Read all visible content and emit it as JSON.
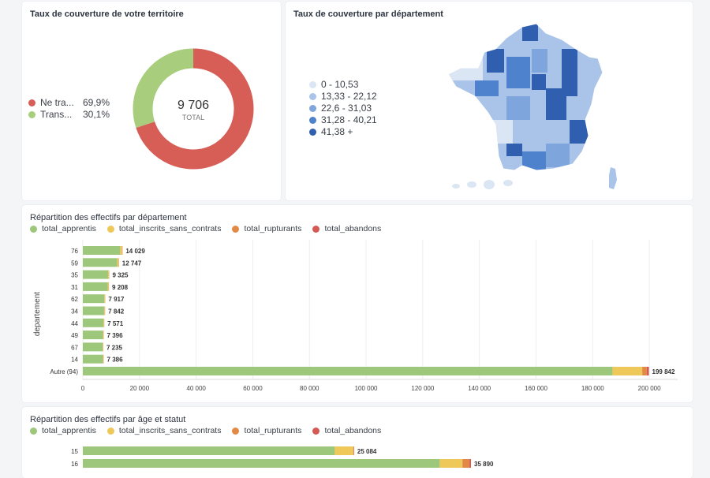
{
  "colors": {
    "apprentis": "#9dc77a",
    "inscrits": "#efc85a",
    "rupturants": "#e28a45",
    "abandons": "#d45a53",
    "donut_red": "#d65e57",
    "donut_green": "#a8cd7c"
  },
  "coverage": {
    "title": "Taux de couverture de votre territoire",
    "total_value": "9 706",
    "total_label": "TOTAL",
    "legend": [
      {
        "label": "Ne tra...",
        "pct": "69,9%",
        "color": "#d65e57"
      },
      {
        "label": "Trans...",
        "pct": "30,1%",
        "color": "#a8cd7c"
      }
    ],
    "chart_data": {
      "type": "pie",
      "categories": [
        "Ne tra...",
        "Trans..."
      ],
      "values": [
        69.9,
        30.1
      ]
    }
  },
  "map": {
    "title": "Taux de couverture par département",
    "legend": [
      {
        "label": "0 - 10,53",
        "color": "#dbe6f4"
      },
      {
        "label": "13,33 - 22,12",
        "color": "#a9c4e8"
      },
      {
        "label": "22,6 - 31,03",
        "color": "#7fa6dc"
      },
      {
        "label": "31,28 - 40,21",
        "color": "#4f82cc"
      },
      {
        "label": "41,38 +",
        "color": "#2f5fae"
      }
    ]
  },
  "dept_chart": {
    "title": "Répartition des effectifs par département",
    "legend": [
      {
        "label": "total_apprentis",
        "color": "#9dc77a"
      },
      {
        "label": "total_inscrits_sans_contrats",
        "color": "#efc85a"
      },
      {
        "label": "total_rupturants",
        "color": "#e28a45"
      },
      {
        "label": "total_abandons",
        "color": "#d45a53"
      }
    ],
    "chart_data": {
      "type": "bar",
      "orientation": "horizontal",
      "stacked": true,
      "ylabel": "departement",
      "xlim": [
        0,
        210000
      ],
      "xticks": [
        "0",
        "20 000",
        "40 000",
        "60 000",
        "80 000",
        "100 000",
        "120 000",
        "140 000",
        "160 000",
        "180 000",
        "200 000"
      ],
      "tick_values": [
        0,
        20000,
        40000,
        60000,
        80000,
        100000,
        120000,
        140000,
        160000,
        180000,
        200000
      ],
      "categories": [
        "76",
        "59",
        "35",
        "31",
        "62",
        "34",
        "44",
        "49",
        "67",
        "14",
        "Autre (94)"
      ],
      "totals_labels": [
        "14 029",
        "12 747",
        "9 325",
        "9 208",
        "7 917",
        "7 842",
        "7 571",
        "7 396",
        "7 235",
        "7 386",
        "199 842"
      ],
      "series": [
        {
          "name": "total_apprentis",
          "values": [
            13200,
            12100,
            8900,
            8800,
            7600,
            7500,
            7250,
            7100,
            6950,
            7100,
            187000
          ]
        },
        {
          "name": "total_inscrits_sans_contrats",
          "values": [
            650,
            500,
            330,
            320,
            250,
            270,
            250,
            230,
            220,
            220,
            10500
          ]
        },
        {
          "name": "total_rupturants",
          "values": [
            120,
            100,
            60,
            60,
            45,
            50,
            50,
            45,
            45,
            45,
            1600
          ]
        },
        {
          "name": "total_abandons",
          "values": [
            59,
            47,
            35,
            28,
            22,
            22,
            21,
            21,
            20,
            21,
            742
          ]
        }
      ]
    }
  },
  "age_chart": {
    "title": "Répartition des effectifs par âge et statut",
    "legend": [
      {
        "label": "total_apprentis",
        "color": "#9dc77a"
      },
      {
        "label": "total_inscrits_sans_contrats",
        "color": "#efc85a"
      },
      {
        "label": "total_rupturants",
        "color": "#e28a45"
      },
      {
        "label": "total_abandons",
        "color": "#d45a53"
      }
    ],
    "chart_data": {
      "type": "bar",
      "orientation": "horizontal",
      "stacked": true,
      "xlim": [
        0,
        55000
      ],
      "categories": [
        "15",
        "16"
      ],
      "totals_labels": [
        "25 084",
        "35 890"
      ],
      "series": [
        {
          "name": "total_apprentis",
          "values": [
            23300,
            33000
          ]
        },
        {
          "name": "total_inscrits_sans_contrats",
          "values": [
            1700,
            2100
          ]
        },
        {
          "name": "total_rupturants",
          "values": [
            60,
            650
          ]
        },
        {
          "name": "total_abandons",
          "values": [
            24,
            140
          ]
        }
      ]
    }
  }
}
